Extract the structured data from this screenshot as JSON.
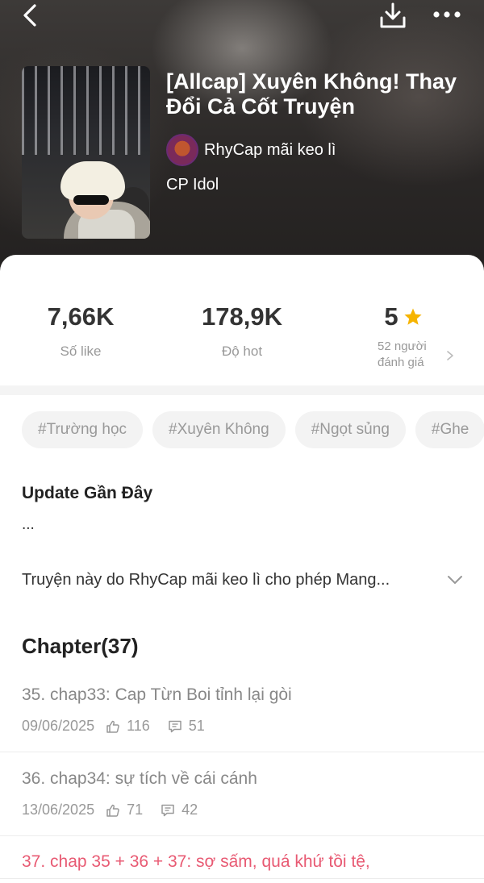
{
  "header": {
    "title": "[Allcap] Xuyên Không! Thay Đổi Cả Cốt Truyện",
    "author": "RhyCap mãi keo lì",
    "genre": "CP Idol",
    "icons": {
      "back": "chevron-left-icon",
      "download": "download-icon",
      "more": "more-dots-icon"
    }
  },
  "stats": {
    "likes": {
      "value": "7,66K",
      "label": "Số like"
    },
    "hot": {
      "value": "178,9K",
      "label": "Độ hot"
    },
    "rating": {
      "value": "5",
      "label_line1": "52 người",
      "label_line2": "đánh giá"
    },
    "star_color": "#f6b400"
  },
  "tags": [
    "#Trường học",
    "#Xuyên Không",
    "#Ngọt sủng",
    "#Ghe"
  ],
  "update": {
    "title": "Update Gần Đây",
    "text": "..."
  },
  "description": {
    "text": "Truyện này do RhyCap mãi keo lì cho phép Mang..."
  },
  "chapters": {
    "title": "Chapter(37)",
    "items": [
      {
        "name": "35. chap33: Cap Từn Boi tỉnh lại gòi",
        "date": "09/06/2025",
        "likes": "116",
        "comments": "51"
      },
      {
        "name": "36. chap34: sự tích về cái cánh",
        "date": "13/06/2025",
        "likes": "71",
        "comments": "42"
      },
      {
        "name": "37. chap 35 + 36 + 37: sợ sấm, quá khứ tồi tệ,"
      }
    ],
    "current_color": "#e85a73"
  }
}
